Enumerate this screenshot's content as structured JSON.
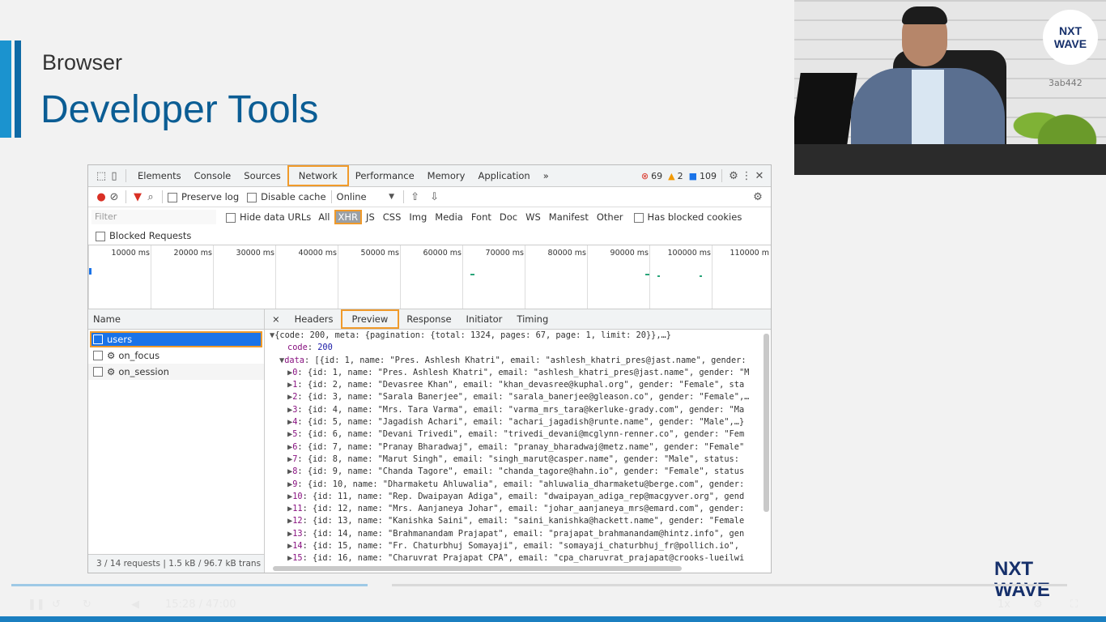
{
  "slide": {
    "subtitle": "Browser",
    "title": "Developer Tools"
  },
  "video": {
    "logo_line1": "NXT",
    "logo_line2": "WAVE",
    "tag": "3ab442"
  },
  "devtools": {
    "tabs": [
      "Elements",
      "Console",
      "Sources",
      "Network",
      "Performance",
      "Memory",
      "Application"
    ],
    "active_tab": "Network",
    "more": "»",
    "errors": "69",
    "warnings": "2",
    "messages": "109",
    "toolbar": {
      "preserve_log": "Preserve log",
      "disable_cache": "Disable cache",
      "throttle": "Online"
    },
    "filter": {
      "placeholder": "Filter",
      "hide_data_urls": "Hide data URLs",
      "types": [
        "All",
        "XHR",
        "JS",
        "CSS",
        "Img",
        "Media",
        "Font",
        "Doc",
        "WS",
        "Manifest",
        "Other"
      ],
      "active_type": "XHR",
      "has_blocked_cookies": "Has blocked cookies",
      "blocked_requests": "Blocked Requests"
    },
    "timeline_ticks": [
      "10000 ms",
      "20000 ms",
      "30000 ms",
      "40000 ms",
      "50000 ms",
      "60000 ms",
      "70000 ms",
      "80000 ms",
      "90000 ms",
      "100000 ms",
      "110000 m"
    ],
    "name_header": "Name",
    "requests": [
      "users",
      "on_focus",
      "on_session"
    ],
    "footer": "3 / 14 requests  |  1.5 kB / 96.7 kB trans",
    "detail_tabs": [
      "×",
      "Headers",
      "Preview",
      "Response",
      "Initiator",
      "Timing"
    ],
    "preview": {
      "root": "{code: 200, meta: {pagination: {total: 1324, pages: 67, page: 1, limit: 20}},…}",
      "code_key": "code",
      "code_val": "200",
      "data_key": "data",
      "data_summary": "[{id: 1, name: \"Pres. Ashlesh Khatri\", email: \"ashlesh_khatri_pres@jast.name\", gender:",
      "items": [
        {
          "idx": "0",
          "text": "{id: 1, name: \"Pres. Ashlesh Khatri\", email: \"ashlesh_khatri_pres@jast.name\", gender: \"M"
        },
        {
          "idx": "1",
          "text": "{id: 2, name: \"Devasree Khan\", email: \"khan_devasree@kuphal.org\", gender: \"Female\", sta"
        },
        {
          "idx": "2",
          "text": "{id: 3, name: \"Sarala Banerjee\", email: \"sarala_banerjee@gleason.co\", gender: \"Female\",…"
        },
        {
          "idx": "3",
          "text": "{id: 4, name: \"Mrs. Tara Varma\", email: \"varma_mrs_tara@kerluke-grady.com\", gender: \"Ma"
        },
        {
          "idx": "4",
          "text": "{id: 5, name: \"Jagadish Achari\", email: \"achari_jagadish@runte.name\", gender: \"Male\",…}"
        },
        {
          "idx": "5",
          "text": "{id: 6, name: \"Devani Trivedi\", email: \"trivedi_devani@mcglynn-renner.co\", gender: \"Fem"
        },
        {
          "idx": "6",
          "text": "{id: 7, name: \"Pranay Bharadwaj\", email: \"pranay_bharadwaj@metz.name\", gender: \"Female\""
        },
        {
          "idx": "7",
          "text": "{id: 8, name: \"Marut Singh\", email: \"singh_marut@casper.name\", gender: \"Male\", status:"
        },
        {
          "idx": "8",
          "text": "{id: 9, name: \"Chanda Tagore\", email: \"chanda_tagore@hahn.io\", gender: \"Female\", status"
        },
        {
          "idx": "9",
          "text": "{id: 10, name: \"Dharmaketu Ahluwalia\", email: \"ahluwalia_dharmaketu@berge.com\", gender:"
        },
        {
          "idx": "10",
          "text": "{id: 11, name: \"Rep. Dwaipayan Adiga\", email: \"dwaipayan_adiga_rep@macgyver.org\", gend"
        },
        {
          "idx": "11",
          "text": "{id: 12, name: \"Mrs. Aanjaneya Johar\", email: \"johar_aanjaneya_mrs@emard.com\", gender:"
        },
        {
          "idx": "12",
          "text": "{id: 13, name: \"Kanishka Saini\", email: \"saini_kanishka@hackett.name\", gender: \"Female"
        },
        {
          "idx": "13",
          "text": "{id: 14, name: \"Brahmanandam Prajapat\", email: \"prajapat_brahmanandam@hintz.info\", gen"
        },
        {
          "idx": "14",
          "text": "{id: 15, name: \"Fr. Chaturbhuj Somayaji\", email: \"somayaji_chaturbhuj_fr@pollich.io\","
        },
        {
          "idx": "15",
          "text": "{id: 16, name: \"Charuvrat Prajapat CPA\", email: \"cpa_charuvrat_prajapat@crooks-lueilwi"
        }
      ]
    }
  },
  "bottom_logo": {
    "line1": "NXT",
    "line2": "WAVE"
  },
  "player": {
    "time": "15:28 / 47:00",
    "speed": "1x",
    "progress": 0.33
  }
}
